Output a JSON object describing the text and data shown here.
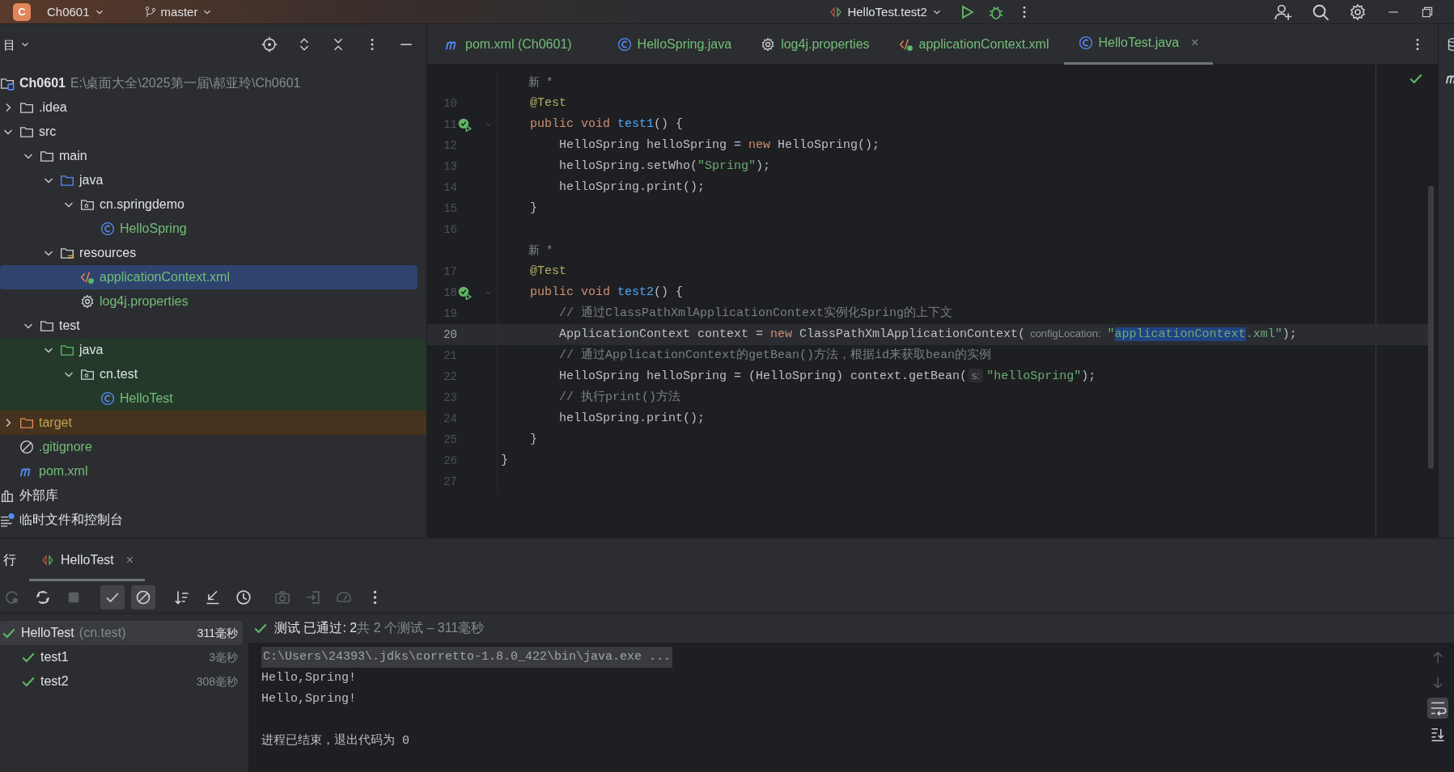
{
  "title_bar": {
    "project_badge": "C",
    "project": "Ch0601",
    "branch": "master",
    "run_config": "HelloTest.test2"
  },
  "project_panel": {
    "title": "目",
    "tree": [
      {
        "label": "Ch0601",
        "path": "E:\\桌面大全\\2025第一届\\郝亚玲\\Ch0601",
        "kind": "project",
        "added": false,
        "excluded": false,
        "test_root": false,
        "selected": false,
        "children": [
          {
            "label": ".idea",
            "kind": "folder",
            "added": false,
            "excluded": false,
            "test_root": false,
            "expanded": false,
            "selected": false
          },
          {
            "label": "src",
            "kind": "folder",
            "added": false,
            "excluded": false,
            "test_root": false,
            "expanded": true,
            "selected": false,
            "children": [
              {
                "label": "main",
                "kind": "folder",
                "added": false,
                "excluded": false,
                "test_root": false,
                "expanded": true,
                "selected": false,
                "children": [
                  {
                    "label": "java",
                    "kind": "source",
                    "added": false,
                    "excluded": false,
                    "test_root": false,
                    "expanded": true,
                    "selected": false,
                    "children": [
                      {
                        "label": "cn.springdemo",
                        "kind": "package",
                        "added": false,
                        "excluded": false,
                        "test_root": false,
                        "expanded": true,
                        "selected": false,
                        "children": [
                          {
                            "label": "HelloSpring",
                            "kind": "class",
                            "added": true,
                            "excluded": false,
                            "test_root": false,
                            "selected": false
                          }
                        ]
                      }
                    ]
                  },
                  {
                    "label": "resources",
                    "kind": "resources",
                    "added": false,
                    "excluded": false,
                    "test_root": false,
                    "expanded": true,
                    "selected": false,
                    "children": [
                      {
                        "label": "applicationContext.xml",
                        "kind": "xml",
                        "added": true,
                        "excluded": false,
                        "test_root": false,
                        "selected": true
                      },
                      {
                        "label": "log4j.properties",
                        "kind": "gear",
                        "added": true,
                        "excluded": false,
                        "test_root": false,
                        "selected": false
                      }
                    ]
                  }
                ]
              },
              {
                "label": "test",
                "kind": "folder",
                "added": false,
                "excluded": false,
                "test_root": false,
                "expanded": true,
                "selected": false,
                "children": [
                  {
                    "label": "java",
                    "kind": "test",
                    "added": false,
                    "excluded": false,
                    "test_root": true,
                    "expanded": true,
                    "selected": false,
                    "children": [
                      {
                        "label": "cn.test",
                        "kind": "package",
                        "added": false,
                        "excluded": false,
                        "test_root": true,
                        "expanded": true,
                        "selected": false,
                        "children": [
                          {
                            "label": "HelloTest",
                            "kind": "class",
                            "added": true,
                            "excluded": false,
                            "test_root": true,
                            "selected": false
                          }
                        ]
                      }
                    ]
                  }
                ]
              }
            ]
          },
          {
            "label": "target",
            "kind": "excluded",
            "added": false,
            "excluded": true,
            "test_root": false,
            "expanded": false,
            "selected": false
          },
          {
            "label": ".gitignore",
            "kind": "ignore",
            "added": true,
            "excluded": false,
            "test_root": false,
            "selected": false
          },
          {
            "label": "pom.xml",
            "kind": "maven",
            "added": true,
            "excluded": false,
            "test_root": false,
            "selected": false
          }
        ]
      },
      {
        "label": "外部库",
        "kind": "library",
        "added": false,
        "excluded": false,
        "test_root": false,
        "selected": false
      },
      {
        "label": "临时文件和控制台",
        "kind": "scratch",
        "added": false,
        "excluded": false,
        "test_root": false,
        "selected": false
      }
    ]
  },
  "editor": {
    "tabs": [
      {
        "label": "pom.xml (Ch0601)",
        "kind": "maven",
        "added": true,
        "selected": false
      },
      {
        "label": "HelloSpring.java",
        "kind": "class",
        "added": true,
        "selected": false
      },
      {
        "label": "log4j.properties",
        "kind": "gear",
        "added": true,
        "selected": false
      },
      {
        "label": "applicationContext.xml",
        "kind": "xml",
        "added": true,
        "selected": false
      },
      {
        "label": "HelloTest.java",
        "kind": "class",
        "added": true,
        "selected": true,
        "close": "×"
      }
    ],
    "lines": [
      {
        "kind": "vision",
        "text": "    新 *"
      },
      {
        "kind": "code",
        "number": "10",
        "current": false,
        "segments": [
          {
            "kind": "ann",
            "s": "    @Test"
          }
        ]
      },
      {
        "kind": "run",
        "number": "11",
        "current": false,
        "segments": [
          {
            "kind": "kw",
            "s": "    public void "
          },
          {
            "kind": "fn",
            "s": "test1"
          },
          {
            "kind": "plain",
            "s": "() {"
          }
        ]
      },
      {
        "kind": "code",
        "number": "12",
        "current": false,
        "segments": [
          {
            "kind": "plain",
            "s": "        HelloSpring helloSpring = "
          },
          {
            "kind": "kw",
            "s": "new"
          },
          {
            "kind": "plain",
            "s": " HelloSpring();"
          }
        ]
      },
      {
        "kind": "code",
        "number": "13",
        "current": false,
        "segments": [
          {
            "kind": "plain",
            "s": "        helloSpring.setWho("
          },
          {
            "kind": "str",
            "s": "\"Spring\""
          },
          {
            "kind": "plain",
            "s": ");"
          }
        ]
      },
      {
        "kind": "code",
        "number": "14",
        "current": false,
        "segments": [
          {
            "kind": "plain",
            "s": "        helloSpring.print();"
          }
        ]
      },
      {
        "kind": "code",
        "number": "15",
        "current": false,
        "segments": [
          {
            "kind": "plain",
            "s": "    }"
          }
        ]
      },
      {
        "kind": "code",
        "number": "16",
        "current": false
      },
      {
        "kind": "vision",
        "text": "    新 *"
      },
      {
        "kind": "code",
        "number": "17",
        "current": false,
        "segments": [
          {
            "kind": "ann",
            "s": "    @Test"
          }
        ]
      },
      {
        "kind": "run",
        "number": "18",
        "current": false,
        "segments": [
          {
            "kind": "kw",
            "s": "    public void "
          },
          {
            "kind": "fn",
            "s": "test2"
          },
          {
            "kind": "plain",
            "s": "() {"
          }
        ]
      },
      {
        "kind": "code",
        "number": "19",
        "current": false,
        "segments": [
          {
            "kind": "cmt",
            "s": "        // 通过ClassPathXmlApplicationContext实例化Spring的上下文"
          }
        ]
      },
      {
        "kind": "code",
        "number": "20",
        "current": true,
        "segments": [
          {
            "kind": "plain",
            "s": "        ApplicationContext context = "
          },
          {
            "kind": "kw",
            "s": "new"
          },
          {
            "kind": "plain",
            "s": " ClassPathXmlApplicationContext("
          },
          {
            "kind": "hint",
            "s": "configLocation:"
          },
          {
            "kind": "str",
            "s": "\""
          },
          {
            "kind": "sel",
            "s": "applicationContext"
          },
          {
            "kind": "str",
            "s": ".xml\""
          },
          {
            "kind": "plain",
            "s": ");"
          }
        ]
      },
      {
        "kind": "code",
        "number": "21",
        "current": false,
        "segments": [
          {
            "kind": "cmt",
            "s": "        // 通过ApplicationContext的getBean()方法，根据id来获取bean的实例"
          }
        ]
      },
      {
        "kind": "code",
        "number": "22",
        "current": false,
        "segments": [
          {
            "kind": "plain",
            "s": "        HelloSpring helloSpring = (HelloSpring) context.getBean("
          },
          {
            "kind": "hint",
            "s": "s:"
          },
          {
            "kind": "str",
            "s": "\"helloSpring\""
          },
          {
            "kind": "plain",
            "s": ");"
          }
        ]
      },
      {
        "kind": "code",
        "number": "23",
        "current": false,
        "segments": [
          {
            "kind": "cmt",
            "s": "        // 执行print()方法"
          }
        ]
      },
      {
        "kind": "code",
        "number": "24",
        "current": false,
        "segments": [
          {
            "kind": "plain",
            "s": "        helloSpring.print();"
          }
        ]
      },
      {
        "kind": "code",
        "number": "25",
        "current": false,
        "segments": [
          {
            "kind": "plain",
            "s": "    }"
          }
        ]
      },
      {
        "kind": "code",
        "number": "26",
        "current": false,
        "segments": [
          {
            "kind": "plain",
            "s": "}"
          }
        ]
      },
      {
        "kind": "code",
        "number": "27",
        "current": false
      }
    ]
  },
  "run_panel": {
    "title": "行",
    "tabs": [
      {
        "label": "HelloTest",
        "selected": true,
        "close": "×"
      }
    ],
    "toolbar": [
      {
        "kind": "rerun",
        "on": false,
        "disabled": true
      },
      {
        "kind": "rerun-failed",
        "on": false,
        "disabled": false
      },
      {
        "kind": "stop",
        "on": false,
        "disabled": true
      },
      {
        "kind": "show-passed",
        "on": true,
        "disabled": false
      },
      {
        "kind": "show-ignored",
        "on": true,
        "disabled": false
      },
      {
        "kind": "sort",
        "on": false,
        "disabled": false
      },
      {
        "kind": "collapse",
        "on": false,
        "disabled": false
      },
      {
        "kind": "history",
        "on": false,
        "disabled": false
      },
      {
        "kind": "snapshot",
        "on": false,
        "disabled": true
      },
      {
        "kind": "import",
        "on": false,
        "disabled": true
      },
      {
        "kind": "coverage",
        "on": false,
        "disabled": true
      },
      {
        "kind": "more",
        "on": false,
        "disabled": false
      }
    ],
    "tests": [
      {
        "name": "HelloTest",
        "package": "(cn.test)",
        "time": "311毫秒",
        "passed": true,
        "selected": true,
        "children": [
          {
            "name": "test1",
            "time": "3毫秒",
            "passed": true,
            "selected": false
          },
          {
            "name": "test2",
            "time": "308毫秒",
            "passed": true,
            "selected": false
          }
        ]
      }
    ],
    "status": {
      "passed": "测试 已通过: 2",
      "summary": "共 2 个测试 – 311毫秒"
    },
    "console": [
      {
        "kind": "command",
        "text": "C:\\Users\\24393\\.jdks\\corretto-1.8.0_422\\bin\\java.exe ..."
      },
      {
        "kind": "output",
        "text": "Hello,Spring!"
      },
      {
        "kind": "output",
        "text": "Hello,Spring!"
      },
      {
        "kind": "exit",
        "text": "进程已结束，退出代码为 0"
      }
    ]
  }
}
